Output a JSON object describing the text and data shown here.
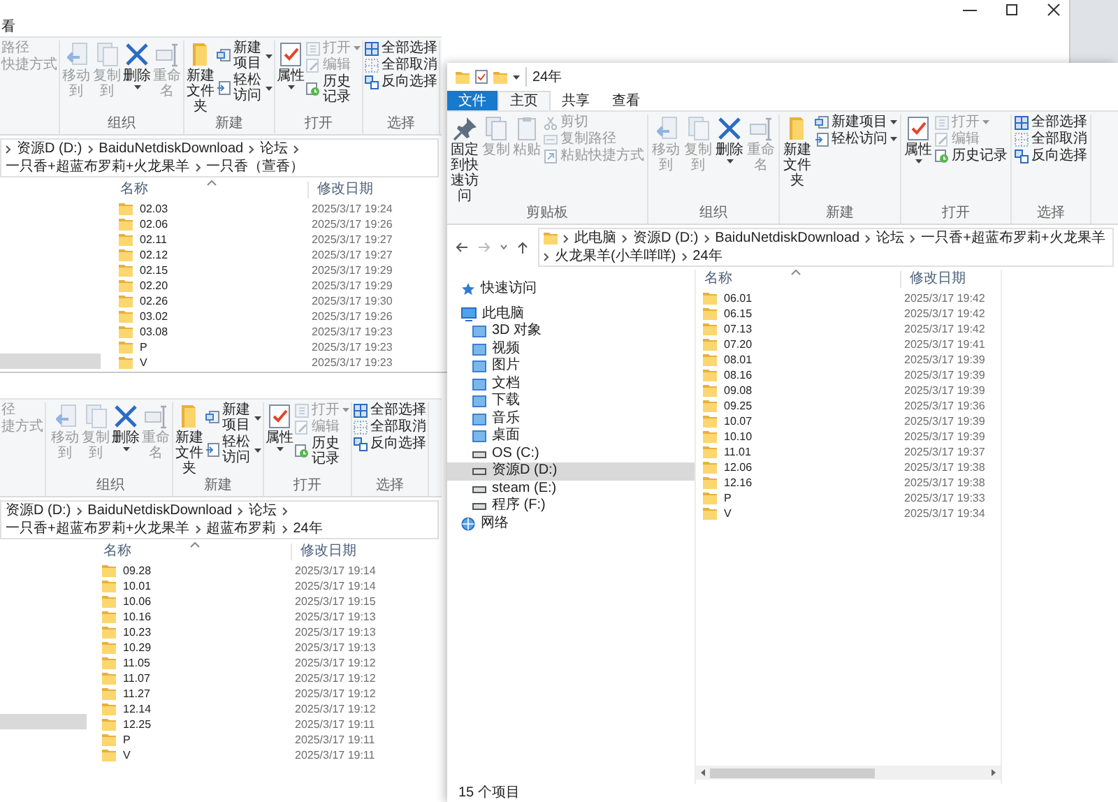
{
  "windows": [
    {
      "kind": "top",
      "tabs": [
        {
          "label": "看",
          "kind": "tab",
          "selected": false
        }
      ],
      "ribbon": [
        {
          "kind": "clipboard",
          "items": [
            {
              "kind": "text",
              "label": "路径",
              "disabled": true,
              "dropdown": false
            },
            {
              "kind": "text",
              "label": "快捷方式",
              "disabled": true,
              "dropdown": false
            }
          ]
        },
        {
          "kind": "organize",
          "label": "组织",
          "items": [
            {
              "kind": "large",
              "label": "移动到",
              "disabled": true,
              "dropdown": false
            },
            {
              "kind": "large",
              "label": "复制到",
              "disabled": true,
              "dropdown": false
            },
            {
              "kind": "large",
              "label": "删除",
              "disabled": false,
              "dropdown": true
            },
            {
              "kind": "large",
              "label": "重命名",
              "disabled": true,
              "dropdown": false
            }
          ]
        },
        {
          "kind": "new",
          "label": "新建",
          "items": [
            {
              "kind": "large",
              "label": "新建文件夹",
              "disabled": false,
              "dropdown": false
            },
            {
              "kind": "small",
              "label": "新建项目",
              "disabled": false,
              "dropdown": true
            },
            {
              "kind": "small",
              "label": "轻松访问",
              "disabled": false,
              "dropdown": true
            }
          ]
        },
        {
          "kind": "open",
          "label": "打开",
          "items": [
            {
              "kind": "large",
              "label": "属性",
              "disabled": false,
              "dropdown": true
            },
            {
              "kind": "small",
              "label": "打开",
              "disabled": true,
              "dropdown": true
            },
            {
              "kind": "small",
              "label": "编辑",
              "disabled": true,
              "dropdown": false
            },
            {
              "kind": "small",
              "label": "历史记录",
              "disabled": false,
              "dropdown": false
            }
          ]
        },
        {
          "kind": "select",
          "label": "选择",
          "items": [
            {
              "kind": "small",
              "label": "全部选择",
              "disabled": false,
              "dropdown": false
            },
            {
              "kind": "small",
              "label": "全部取消",
              "disabled": false,
              "dropdown": false
            },
            {
              "kind": "small",
              "label": "反向选择",
              "disabled": false,
              "dropdown": false
            }
          ]
        }
      ],
      "address": {
        "cut_left": true,
        "nav_buttons": false,
        "path": [
          "资源D (D:)",
          "BaiduNetdiskDownload",
          "论坛",
          "一只香+超蓝布罗莉+火龙果羊",
          "一只香（萱香）"
        ]
      },
      "columns": [
        "名称",
        "修改日期"
      ],
      "nav_highlight": true,
      "files": [
        {
          "name": "02.03",
          "modified": "2025/3/17 19:24"
        },
        {
          "name": "02.06",
          "modified": "2025/3/17 19:26"
        },
        {
          "name": "02.11",
          "modified": "2025/3/17 19:27"
        },
        {
          "name": "02.12",
          "modified": "2025/3/17 19:27"
        },
        {
          "name": "02.15",
          "modified": "2025/3/17 19:29"
        },
        {
          "name": "02.20",
          "modified": "2025/3/17 19:29"
        },
        {
          "name": "02.26",
          "modified": "2025/3/17 19:30"
        },
        {
          "name": "03.02",
          "modified": "2025/3/17 19:26"
        },
        {
          "name": "03.08",
          "modified": "2025/3/17 19:23"
        },
        {
          "name": "P",
          "modified": "2025/3/17 19:23"
        },
        {
          "name": "V",
          "modified": "2025/3/17 19:23"
        }
      ]
    },
    {
      "kind": "partial",
      "ribbon": [
        {
          "kind": "clipboard",
          "items": [
            {
              "kind": "text",
              "label": "径",
              "disabled": true,
              "dropdown": false
            },
            {
              "kind": "text",
              "label": "捷方式",
              "disabled": true,
              "dropdown": false
            }
          ]
        },
        {
          "kind": "organize",
          "label": "组织",
          "items": [
            {
              "kind": "large",
              "label": "移动到",
              "disabled": true,
              "dropdown": false
            },
            {
              "kind": "large",
              "label": "复制到",
              "disabled": true,
              "dropdown": false
            },
            {
              "kind": "large",
              "label": "删除",
              "disabled": false,
              "dropdown": true
            },
            {
              "kind": "large",
              "label": "重命名",
              "disabled": true,
              "dropdown": false
            }
          ]
        },
        {
          "kind": "new",
          "label": "新建",
          "items": [
            {
              "kind": "large",
              "label": "新建文件夹",
              "disabled": false,
              "dropdown": false
            },
            {
              "kind": "small",
              "label": "新建项目",
              "disabled": false,
              "dropdown": true
            },
            {
              "kind": "small",
              "label": "轻松访问",
              "disabled": false,
              "dropdown": true
            }
          ]
        },
        {
          "kind": "open",
          "label": "打开",
          "items": [
            {
              "kind": "large",
              "label": "属性",
              "disabled": false,
              "dropdown": true
            },
            {
              "kind": "small",
              "label": "打开",
              "disabled": true,
              "dropdown": true
            },
            {
              "kind": "small",
              "label": "编辑",
              "disabled": true,
              "dropdown": false
            },
            {
              "kind": "small",
              "label": "历史记录",
              "disabled": false,
              "dropdown": false
            }
          ]
        },
        {
          "kind": "select",
          "label": "选择",
          "items": [
            {
              "kind": "small",
              "label": "全部选择",
              "disabled": false,
              "dropdown": false
            },
            {
              "kind": "small",
              "label": "全部取消",
              "disabled": false,
              "dropdown": false
            },
            {
              "kind": "small",
              "label": "反向选择",
              "disabled": false,
              "dropdown": false
            }
          ]
        }
      ],
      "address": {
        "cut_left": false,
        "nav_buttons": false,
        "path": [
          "资源D (D:)",
          "BaiduNetdiskDownload",
          "论坛",
          "一只香+超蓝布罗莉+火龙果羊",
          "超蓝布罗莉",
          "24年"
        ]
      },
      "columns": [
        "名称",
        "修改日期"
      ],
      "nav_highlight": true,
      "files": [
        {
          "name": "09.28",
          "modified": "2025/3/17 19:14"
        },
        {
          "name": "10.01",
          "modified": "2025/3/17 19:14"
        },
        {
          "name": "10.06",
          "modified": "2025/3/17 19:15"
        },
        {
          "name": "10.16",
          "modified": "2025/3/17 19:13"
        },
        {
          "name": "10.23",
          "modified": "2025/3/17 19:13"
        },
        {
          "name": "10.29",
          "modified": "2025/3/17 19:13"
        },
        {
          "name": "11.05",
          "modified": "2025/3/17 19:12"
        },
        {
          "name": "11.07",
          "modified": "2025/3/17 19:12"
        },
        {
          "name": "11.27",
          "modified": "2025/3/17 19:12"
        },
        {
          "name": "12.14",
          "modified": "2025/3/17 19:12"
        },
        {
          "name": "12.25",
          "modified": "2025/3/17 19:11"
        },
        {
          "name": "P",
          "modified": "2025/3/17 19:11"
        },
        {
          "name": "V",
          "modified": "2025/3/17 19:11"
        }
      ]
    },
    {
      "kind": "full",
      "title": "24年",
      "tabs": [
        {
          "label": "文件",
          "kind": "file",
          "selected": false
        },
        {
          "label": "主页",
          "kind": "tab",
          "selected": true
        },
        {
          "label": "共享",
          "kind": "tab",
          "selected": false
        },
        {
          "label": "查看",
          "kind": "tab",
          "selected": false
        }
      ],
      "ribbon": [
        {
          "kind": "clipboard",
          "label": "剪贴板",
          "items": [
            {
              "kind": "large",
              "label": "固定到快速访问",
              "disabled": false,
              "dropdown": false
            },
            {
              "kind": "large",
              "label": "复制",
              "disabled": true,
              "dropdown": false
            },
            {
              "kind": "large",
              "label": "粘贴",
              "disabled": true,
              "dropdown": false
            },
            {
              "kind": "small",
              "label": "剪切",
              "disabled": true,
              "dropdown": false
            },
            {
              "kind": "small",
              "label": "复制路径",
              "disabled": true,
              "dropdown": false
            },
            {
              "kind": "small",
              "label": "粘贴快捷方式",
              "disabled": true,
              "dropdown": false
            }
          ]
        },
        {
          "kind": "organize",
          "label": "组织",
          "items": [
            {
              "kind": "large",
              "label": "移动到",
              "disabled": true,
              "dropdown": false
            },
            {
              "kind": "large",
              "label": "复制到",
              "disabled": true,
              "dropdown": false
            },
            {
              "kind": "large",
              "label": "删除",
              "disabled": false,
              "dropdown": true
            },
            {
              "kind": "large",
              "label": "重命名",
              "disabled": true,
              "dropdown": false
            }
          ]
        },
        {
          "kind": "new",
          "label": "新建",
          "items": [
            {
              "kind": "large",
              "label": "新建文件夹",
              "disabled": false,
              "dropdown": false
            },
            {
              "kind": "small",
              "label": "新建项目",
              "disabled": false,
              "dropdown": true
            },
            {
              "kind": "small",
              "label": "轻松访问",
              "disabled": false,
              "dropdown": true
            }
          ]
        },
        {
          "kind": "open",
          "label": "打开",
          "items": [
            {
              "kind": "large",
              "label": "属性",
              "disabled": false,
              "dropdown": true
            },
            {
              "kind": "small",
              "label": "打开",
              "disabled": true,
              "dropdown": true
            },
            {
              "kind": "small",
              "label": "编辑",
              "disabled": true,
              "dropdown": false
            },
            {
              "kind": "small",
              "label": "历史记录",
              "disabled": false,
              "dropdown": false
            }
          ]
        },
        {
          "kind": "select",
          "label": "选择",
          "items": [
            {
              "kind": "small",
              "label": "全部选择",
              "disabled": false,
              "dropdown": false
            },
            {
              "kind": "small",
              "label": "全部取消",
              "disabled": false,
              "dropdown": false
            },
            {
              "kind": "small",
              "label": "反向选择",
              "disabled": false,
              "dropdown": false
            }
          ]
        }
      ],
      "address": {
        "cut_left": false,
        "nav_buttons": true,
        "path": [
          "此电脑",
          "资源D (D:)",
          "BaiduNetdiskDownload",
          "论坛",
          "一只香+超蓝布罗莉+火龙果羊",
          "火龙果羊(小羊咩咩)",
          "24年"
        ]
      },
      "nav": [
        {
          "label": "快速访问",
          "kind": "quick_access",
          "selected": false
        },
        {
          "label": "此电脑",
          "kind": "computer",
          "selected": false,
          "children": [
            {
              "label": "3D 对象",
              "kind": "library",
              "selected": false
            },
            {
              "label": "视频",
              "kind": "library",
              "selected": false
            },
            {
              "label": "图片",
              "kind": "library",
              "selected": false
            },
            {
              "label": "文档",
              "kind": "library",
              "selected": false
            },
            {
              "label": "下载",
              "kind": "library",
              "selected": false
            },
            {
              "label": "音乐",
              "kind": "library",
              "selected": false
            },
            {
              "label": "桌面",
              "kind": "library",
              "selected": false
            },
            {
              "label": "OS (C:)",
              "kind": "drive",
              "selected": false
            },
            {
              "label": "资源D (D:)",
              "kind": "drive",
              "selected": true
            },
            {
              "label": "steam (E:)",
              "kind": "drive",
              "selected": false
            },
            {
              "label": "程序 (F:)",
              "kind": "drive",
              "selected": false
            }
          ]
        },
        {
          "label": "网络",
          "kind": "network",
          "selected": false
        }
      ],
      "columns": [
        "名称",
        "修改日期"
      ],
      "files": [
        {
          "name": "06.01",
          "modified": "2025/3/17 19:42"
        },
        {
          "name": "06.15",
          "modified": "2025/3/17 19:42"
        },
        {
          "name": "07.13",
          "modified": "2025/3/17 19:42"
        },
        {
          "name": "07.20",
          "modified": "2025/3/17 19:41"
        },
        {
          "name": "08.01",
          "modified": "2025/3/17 19:39"
        },
        {
          "name": "08.16",
          "modified": "2025/3/17 19:39"
        },
        {
          "name": "09.08",
          "modified": "2025/3/17 19:39"
        },
        {
          "name": "09.25",
          "modified": "2025/3/17 19:36"
        },
        {
          "name": "10.07",
          "modified": "2025/3/17 19:39"
        },
        {
          "name": "10.10",
          "modified": "2025/3/17 19:39"
        },
        {
          "name": "11.01",
          "modified": "2025/3/17 19:37"
        },
        {
          "name": "12.06",
          "modified": "2025/3/17 19:38"
        },
        {
          "name": "12.16",
          "modified": "2025/3/17 19:38"
        },
        {
          "name": "P",
          "modified": "2025/3/17 19:33"
        },
        {
          "name": "V",
          "modified": "2025/3/17 19:34"
        }
      ],
      "h_scrollbar": true,
      "status": "15 个项目"
    }
  ]
}
